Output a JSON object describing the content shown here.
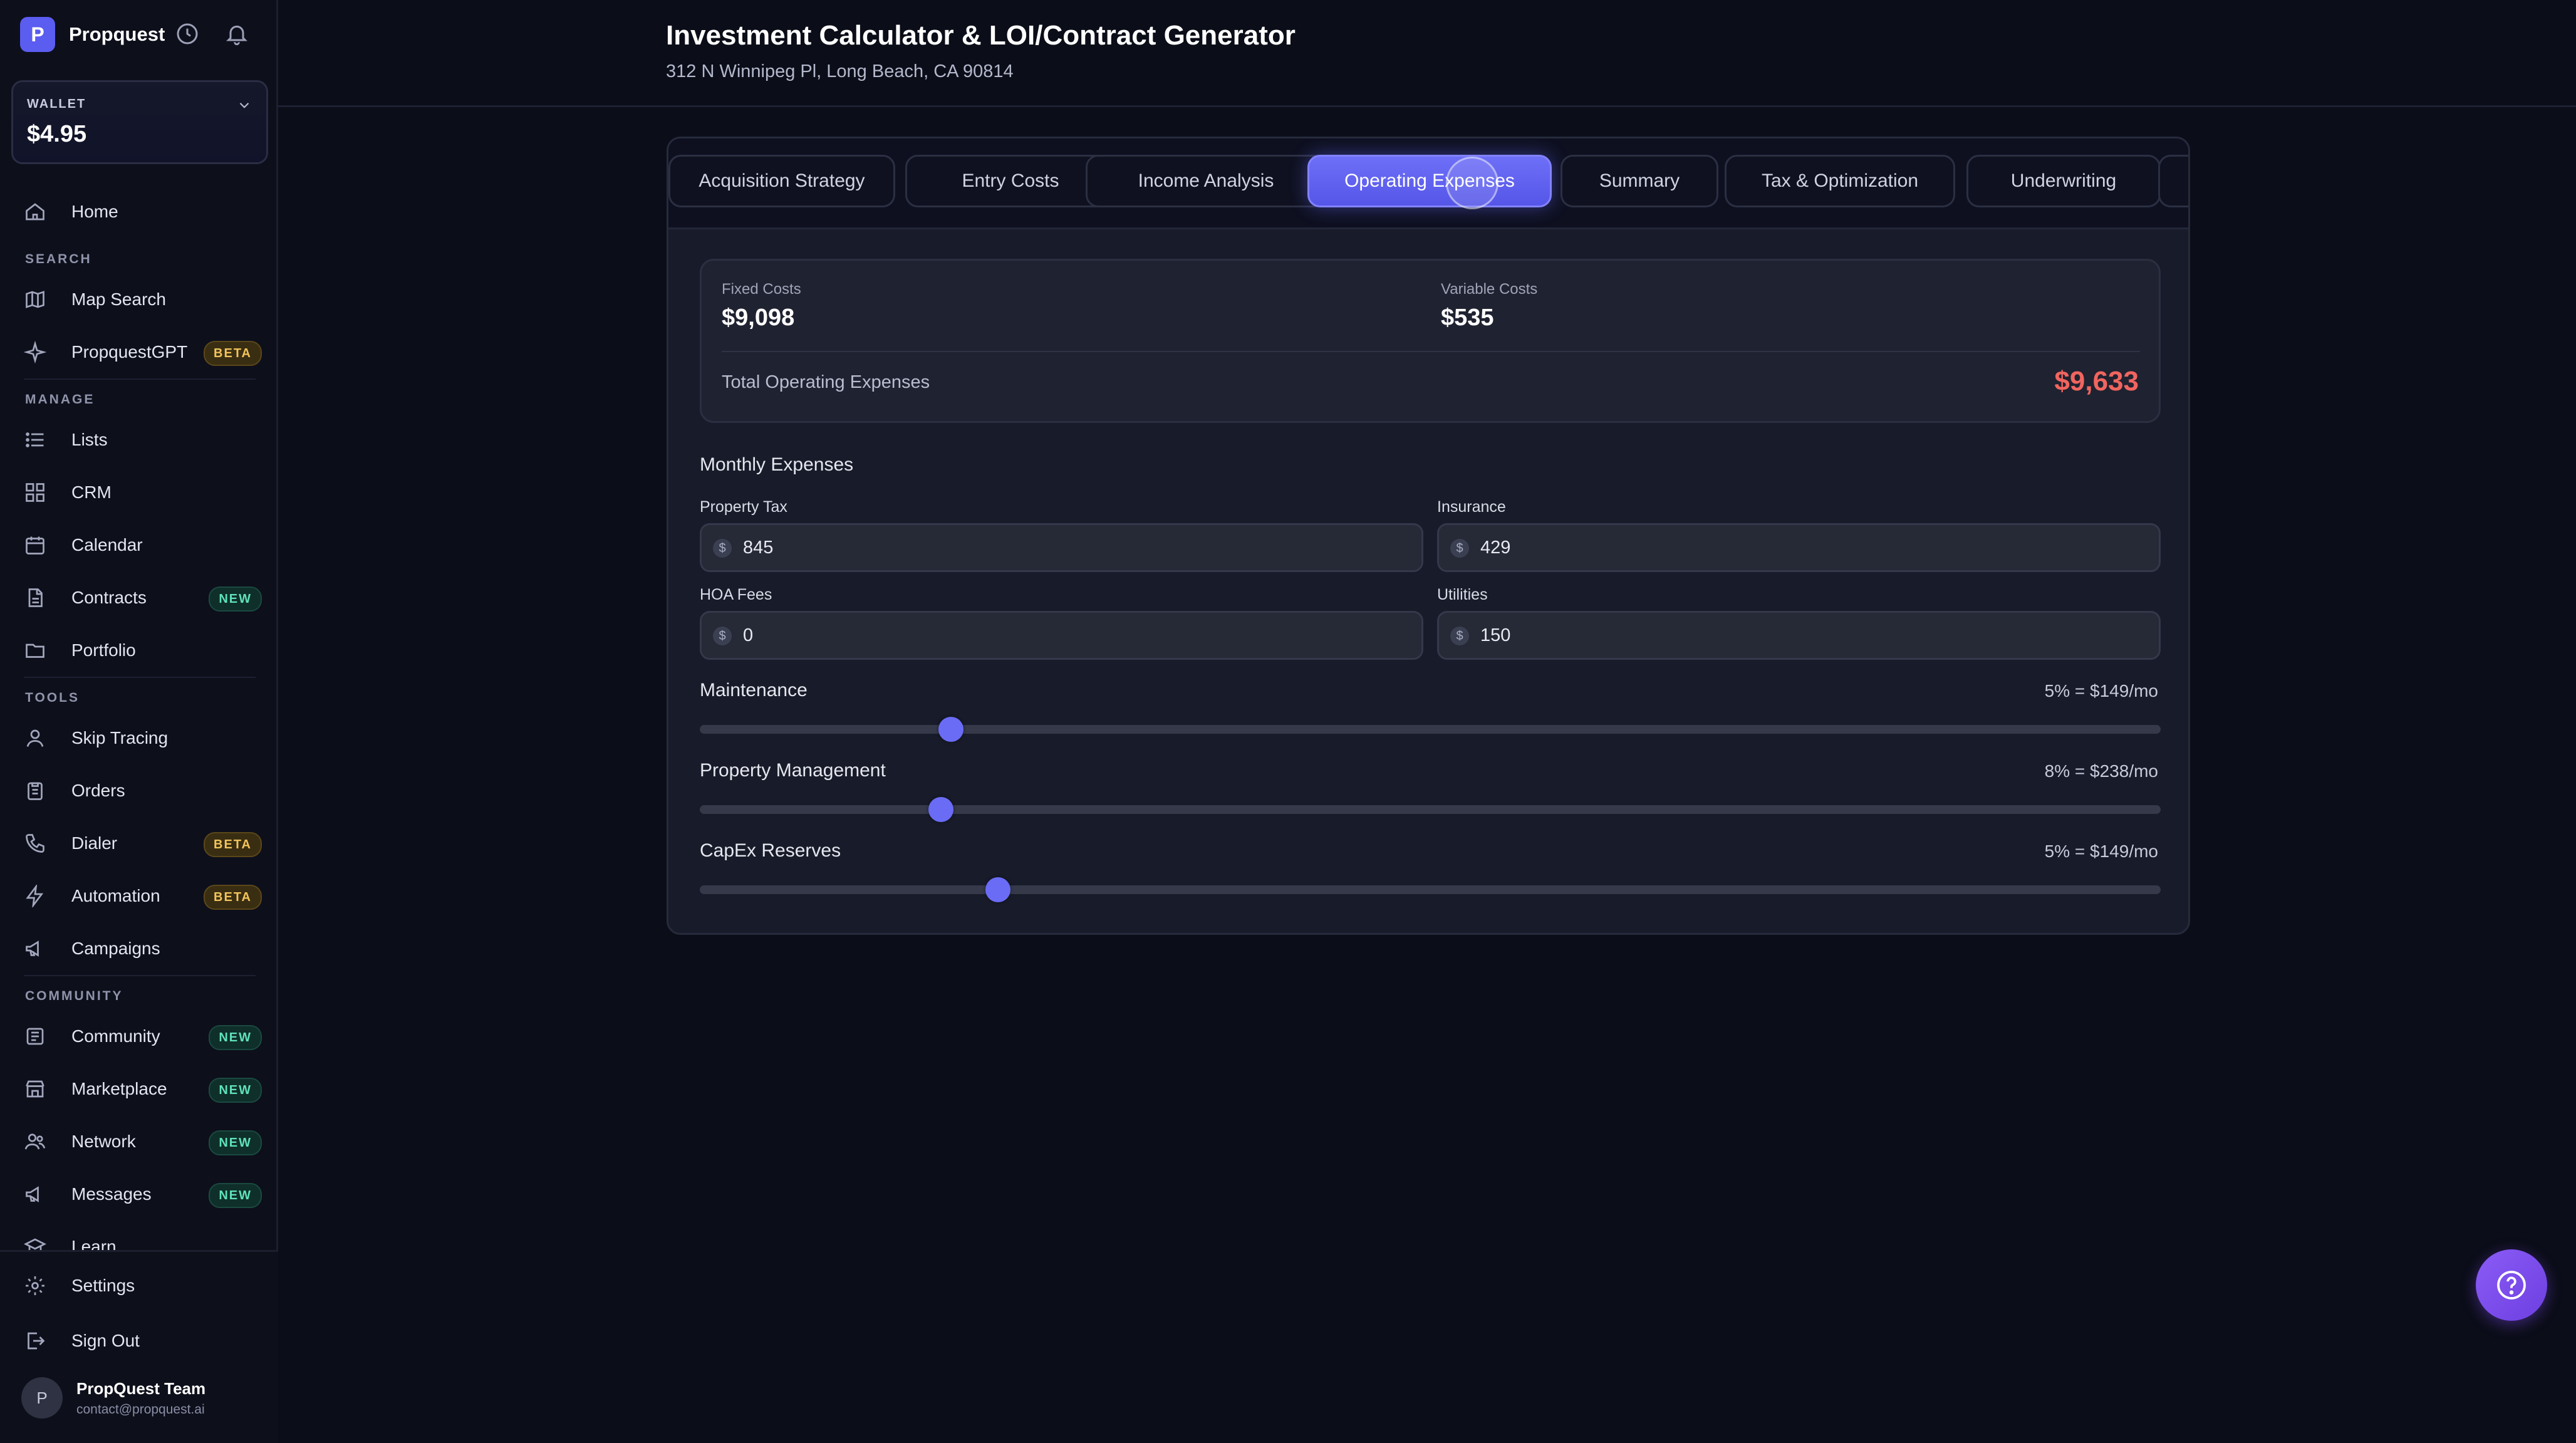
{
  "app": {
    "brand": "Propquest",
    "logo_text": "P",
    "header_icons": [
      "history-icon",
      "bell-icon"
    ]
  },
  "wallet": {
    "label": "WALLET",
    "value": "$4.95"
  },
  "sidebar": {
    "home": {
      "label": "Home",
      "icon": "home-icon"
    },
    "sections": {
      "search": "SEARCH",
      "manage": "MANAGE",
      "tools": "TOOLS",
      "community": "COMMUNITY"
    },
    "items": [
      {
        "label": "Map Search",
        "icon": "map-icon",
        "badge": ""
      },
      {
        "label": "PropquestGPT",
        "icon": "sparkle-icon",
        "badge": "BETA"
      },
      {
        "label": "Lists",
        "icon": "list-icon",
        "badge": ""
      },
      {
        "label": "CRM",
        "icon": "grid-icon",
        "badge": ""
      },
      {
        "label": "Calendar",
        "icon": "calendar-icon",
        "badge": ""
      },
      {
        "label": "Contracts",
        "icon": "document-icon",
        "badge": "NEW"
      },
      {
        "label": "Portfolio",
        "icon": "folder-icon",
        "badge": ""
      },
      {
        "label": "Skip Tracing",
        "icon": "user-icon",
        "badge": ""
      },
      {
        "label": "Orders",
        "icon": "clipboard-icon",
        "badge": ""
      },
      {
        "label": "Dialer",
        "icon": "phone-icon",
        "badge": "BETA"
      },
      {
        "label": "Automation",
        "icon": "lightning-icon",
        "badge": "BETA"
      },
      {
        "label": "Campaigns",
        "icon": "megaphone-icon",
        "badge": ""
      },
      {
        "label": "Community",
        "icon": "newspaper-icon",
        "badge": "NEW"
      },
      {
        "label": "Marketplace",
        "icon": "store-icon",
        "badge": "NEW"
      },
      {
        "label": "Network",
        "icon": "users-icon",
        "badge": "NEW"
      },
      {
        "label": "Messages",
        "icon": "megaphone-icon",
        "badge": "NEW"
      },
      {
        "label": "Learn",
        "icon": "graduation-cap-icon",
        "badge": ""
      }
    ],
    "settings": "Settings",
    "sign_out": "Sign Out",
    "user": {
      "initial": "P",
      "name": "PropQuest Team",
      "email": "contact@propquest.ai"
    }
  },
  "header": {
    "title": "Investment Calculator & LOI/Contract Generator",
    "address": "312 N Winnipeg Pl, Long Beach, CA 90814"
  },
  "tabs": [
    {
      "label": "Acquisition Strategy",
      "active": false
    },
    {
      "label": "Entry Costs",
      "active": false
    },
    {
      "label": "Income Analysis",
      "active": false
    },
    {
      "label": "Operating Expenses",
      "active": true
    },
    {
      "label": "Summary",
      "active": false
    },
    {
      "label": "Tax & Optimization",
      "active": false
    },
    {
      "label": "Underwriting",
      "active": false
    }
  ],
  "summary": {
    "fixed_label": "Fixed Costs",
    "fixed_value": "$9,098",
    "variable_label": "Variable Costs",
    "variable_value": "$535",
    "total_label": "Total Operating Expenses",
    "total_value": "$9,633",
    "total_color": "#f0655f"
  },
  "monthly": {
    "heading": "Monthly Expenses",
    "currency_symbol": "$",
    "fields": [
      {
        "label": "Property Tax",
        "value": "845"
      },
      {
        "label": "Insurance",
        "value": "429"
      },
      {
        "label": "HOA Fees",
        "value": "0"
      },
      {
        "label": "Utilities",
        "value": "150"
      }
    ]
  },
  "sliders": [
    {
      "label": "Maintenance",
      "readout": "5% = $149/mo",
      "position": 0.172
    },
    {
      "label": "Property Management",
      "readout": "8% = $238/mo",
      "position": 0.165
    },
    {
      "label": "CapEx Reserves",
      "readout": "5% = $149/mo",
      "position": 0.204
    }
  ],
  "colors": {
    "accent": "#6a6cf6",
    "background": "#0b0d18",
    "negative": "#f0655f"
  }
}
